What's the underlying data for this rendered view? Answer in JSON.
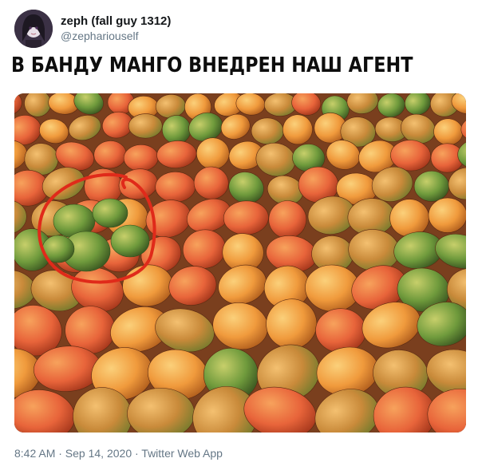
{
  "tweet": {
    "display_name": "zeph (fall guy 1312)",
    "handle": "@zephariouself",
    "caption": "В БАНДУ МАНГО ВНЕДРЕН НАШ АГЕНТ",
    "timestamp": "8:42 AM · Sep 14, 2020 · Twitter Web App",
    "avatar_icon": "anime-avatar-icon"
  },
  "colors": {
    "mango_red": "#e8643a",
    "mango_orange": "#f09a3c",
    "mango_green": "#6f9a3c",
    "circle": "#e02a1a",
    "handle_gray": "#657786"
  }
}
